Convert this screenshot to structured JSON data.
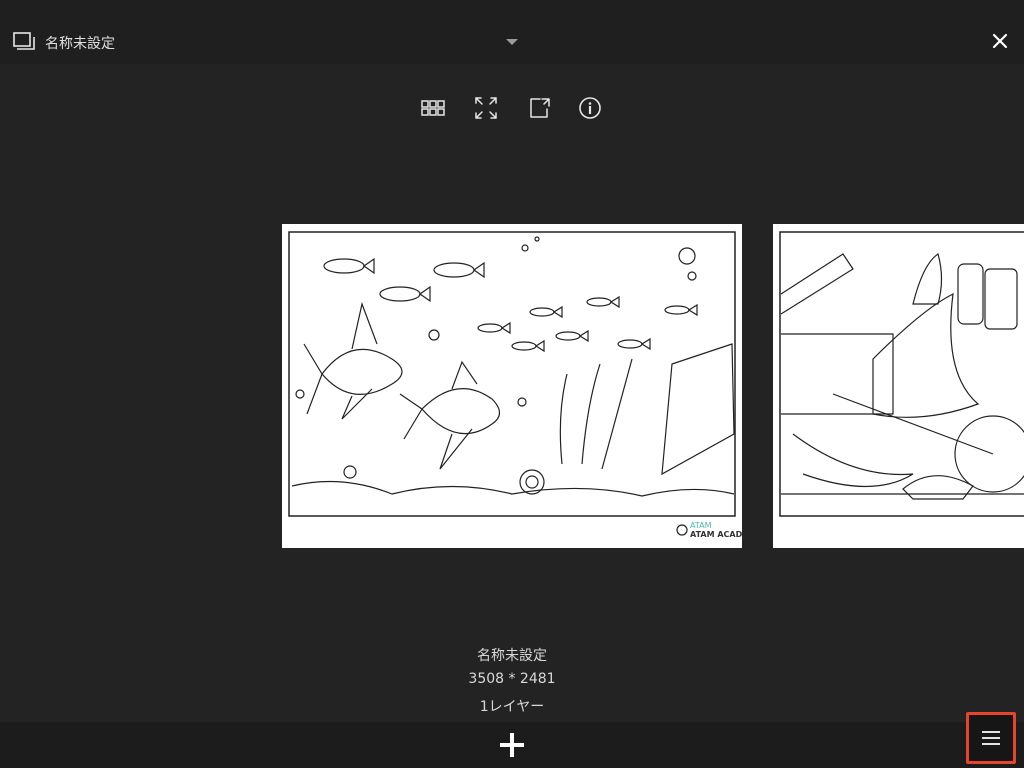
{
  "header": {
    "title": "名称未設定",
    "icons": {
      "gallery": "gallery-stack-icon",
      "dropdown": "chevron-down-icon",
      "close": "close-icon"
    }
  },
  "toolbar": {
    "icons": [
      "grid-view-icon",
      "fullscreen-icon",
      "share-export-icon",
      "info-icon"
    ]
  },
  "canvases": [
    {
      "name": "名称未設定",
      "logo_text": "ATAM ACADEMY",
      "selected": true
    },
    {
      "name": "",
      "selected": false
    }
  ],
  "canvas_info": {
    "name": "名称未設定",
    "dimensions": "3508 * 2481",
    "layers": "1レイヤー"
  },
  "bottombar": {
    "icons": {
      "add": "plus-icon",
      "menu": "hamburger-menu-icon"
    }
  },
  "colors": {
    "background": "#232323",
    "bar": "#1f1f1f",
    "highlight": "#e8442a"
  }
}
